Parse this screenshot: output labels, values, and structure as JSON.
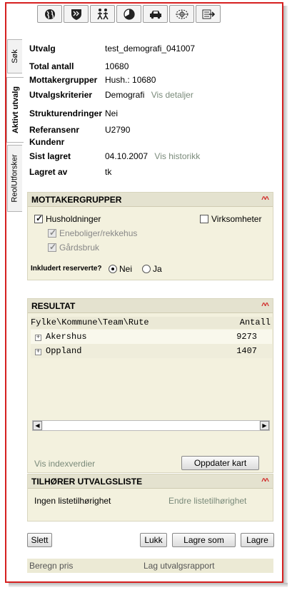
{
  "toolbar": {
    "icons": [
      "globe-icon",
      "shield-icon",
      "people-icon",
      "pie-chart-icon",
      "car-icon",
      "target-icon",
      "export-icon"
    ]
  },
  "tabs": {
    "sok": "Søk",
    "aktivt": "Aktivt utvalg",
    "reol": "ReolUtforsker"
  },
  "info": {
    "utvalg_label": "Utvalg",
    "utvalg_value": "test_demografi_041007",
    "total_label": "Total antall",
    "total_value": "10680",
    "mottaker_label": "Mottakergrupper",
    "mottaker_value": "Hush.: 10680",
    "kriterier_label": "Utvalgskriterier",
    "kriterier_value": "Demografi",
    "kriterier_link": "Vis detaljer",
    "struktur_label": "Strukturendringer",
    "struktur_value": "Nei",
    "referanse_label": "Referansenr",
    "referanse_value": "U2790",
    "kundenr_label": "Kundenr",
    "sist_label": "Sist lagret",
    "sist_value": "04.10.2007",
    "sist_link": "Vis historikk",
    "lagret_label": "Lagret av",
    "lagret_value": "tk"
  },
  "mottakergrupper": {
    "title": "MOTTAKERGRUPPER",
    "husholdninger": "Husholdninger",
    "virksomheter": "Virksomheter",
    "eneboliger": "Eneboliger/rekkehus",
    "gardsbruk": "Gårdsbruk",
    "reserverte_label": "Inkludert reserverte?",
    "nei": "Nei",
    "ja": "Ja"
  },
  "resultat": {
    "title": "RESULTAT",
    "col_path": "Fylke\\Kommune\\Team\\Rute",
    "col_antall": "Antall",
    "rows": [
      {
        "name": "Akershus",
        "antall": "9273"
      },
      {
        "name": "Oppland",
        "antall": "1407"
      }
    ],
    "index_link": "Vis indexverdier",
    "update_button": "Oppdater kart"
  },
  "tilhorer": {
    "title": "TILHØRER UTVALGSLISTE",
    "none_text": "Ingen listetilhørighet",
    "edit_link": "Endre listetilhørighet"
  },
  "actions": {
    "slett": "Slett",
    "lukk": "Lukk",
    "lagre_som": "Lagre som",
    "lagre": "Lagre"
  },
  "footer": {
    "beregn": "Beregn pris",
    "rapport": "Lag utvalgsrapport"
  },
  "colors": {
    "frame_red": "#d62020",
    "panel_bg": "#f3f1de",
    "panel_head": "#e4e2cf",
    "link_gray": "#7a8a7a"
  }
}
